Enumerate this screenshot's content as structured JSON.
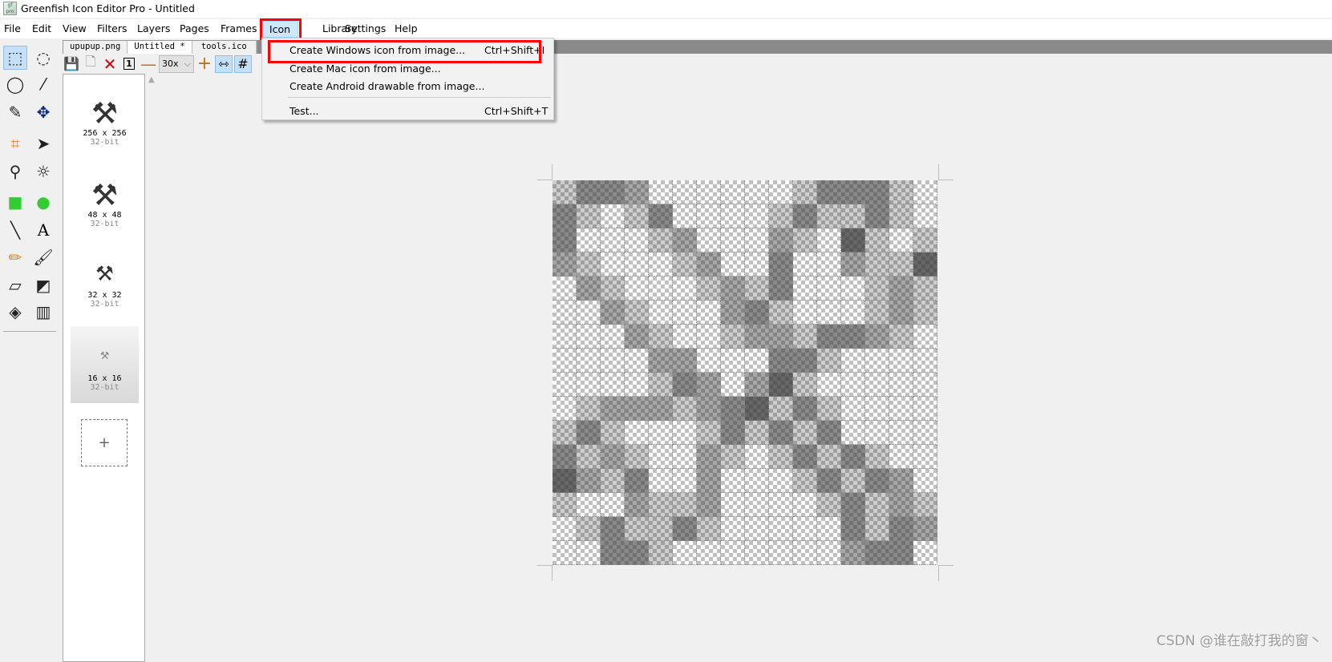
{
  "window": {
    "title": "Greenfish Icon Editor Pro - Untitled"
  },
  "menubar": [
    "File",
    "Edit",
    "View",
    "Filters",
    "Layers",
    "Pages",
    "Frames",
    "Icon",
    "Library",
    "Settings",
    "Help"
  ],
  "icon_menu": {
    "items": [
      {
        "label": "Create Windows icon from image...",
        "shortcut": "Ctrl+Shift+I",
        "highlighted": true
      },
      {
        "label": "Create Mac icon from image...",
        "shortcut": ""
      },
      {
        "label": "Create Android drawable from image...",
        "shortcut": ""
      },
      {
        "label": "Test...",
        "shortcut": "Ctrl+Shift+T"
      }
    ]
  },
  "tools": [
    "rect-select",
    "ellipse-select",
    "lasso",
    "magic-wand",
    "pen-select",
    "move",
    "crop",
    "pointer",
    "color-picker",
    "color-replace",
    "rectangle",
    "ellipse",
    "line",
    "text",
    "pencil",
    "brush",
    "eraser",
    "swap-colors",
    "fill",
    "gradient"
  ],
  "tabs": [
    "upupup.png",
    "Untitled *",
    "tools.ico"
  ],
  "doc_toolbar": {
    "zoom": "30x",
    "zoom_options_chevron": "⌵",
    "page_number": "1"
  },
  "pages": [
    {
      "size": "256 x 256",
      "depth": "32-bit",
      "selected": false
    },
    {
      "size": "48 x 48",
      "depth": "32-bit",
      "selected": false
    },
    {
      "size": "32 x 32",
      "depth": "32-bit",
      "selected": false
    },
    {
      "size": "16 x 16",
      "depth": "32-bit",
      "selected": true
    }
  ],
  "add_page": "+",
  "canvas": {
    "width": 16,
    "height": 16,
    "alpha_levels": [
      [
        1,
        3,
        3,
        2,
        0,
        0,
        0,
        0,
        0,
        0,
        1,
        3,
        3,
        3,
        1,
        0
      ],
      [
        3,
        1,
        0,
        1,
        3,
        0,
        0,
        0,
        0,
        1,
        3,
        1,
        1,
        3,
        1,
        0
      ],
      [
        3,
        0,
        0,
        0,
        1,
        2,
        0,
        0,
        0,
        2,
        1,
        0,
        4,
        1,
        0,
        1
      ],
      [
        2,
        1,
        0,
        0,
        0,
        1,
        2,
        0,
        0,
        3,
        0,
        0,
        2,
        1,
        1,
        4
      ],
      [
        0,
        2,
        1,
        0,
        0,
        0,
        1,
        2,
        1,
        3,
        0,
        0,
        0,
        1,
        2,
        1
      ],
      [
        0,
        0,
        2,
        1,
        0,
        0,
        0,
        2,
        3,
        1,
        0,
        0,
        0,
        1,
        2,
        1
      ],
      [
        0,
        0,
        0,
        2,
        1,
        0,
        0,
        1,
        2,
        2,
        1,
        3,
        3,
        2,
        1,
        0
      ],
      [
        0,
        0,
        0,
        0,
        2,
        2,
        0,
        0,
        0,
        3,
        3,
        1,
        0,
        0,
        0,
        0
      ],
      [
        0,
        0,
        0,
        0,
        1,
        3,
        2,
        0,
        2,
        4,
        1,
        0,
        0,
        0,
        0,
        0
      ],
      [
        0,
        1,
        2,
        2,
        2,
        1,
        2,
        3,
        4,
        1,
        3,
        1,
        0,
        0,
        0,
        0
      ],
      [
        1,
        3,
        1,
        0,
        0,
        0,
        1,
        3,
        1,
        3,
        1,
        3,
        0,
        0,
        0,
        0
      ],
      [
        3,
        1,
        2,
        1,
        0,
        0,
        2,
        1,
        0,
        1,
        3,
        1,
        3,
        1,
        0,
        0
      ],
      [
        4,
        2,
        1,
        3,
        0,
        0,
        2,
        0,
        0,
        0,
        1,
        3,
        1,
        3,
        2,
        0
      ],
      [
        1,
        0,
        0,
        2,
        1,
        1,
        2,
        0,
        0,
        0,
        0,
        1,
        3,
        1,
        2,
        1
      ],
      [
        0,
        1,
        3,
        1,
        1,
        3,
        1,
        0,
        0,
        0,
        0,
        0,
        3,
        1,
        3,
        2
      ],
      [
        0,
        0,
        3,
        3,
        1,
        0,
        0,
        0,
        0,
        0,
        0,
        0,
        2,
        3,
        3,
        0
      ]
    ]
  },
  "highlight_color": "#ff0000",
  "watermark": "CSDN @谁在敲打我的窗丶"
}
